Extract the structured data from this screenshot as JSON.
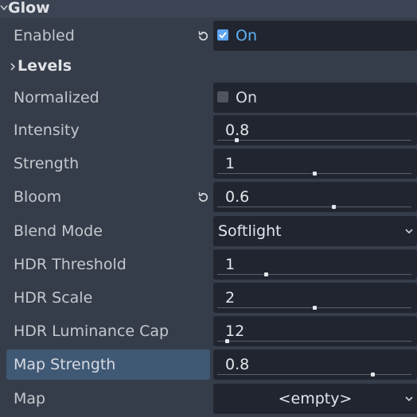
{
  "section": {
    "title": "Glow"
  },
  "levels": {
    "title": "Levels"
  },
  "enabled": {
    "label": "Enabled",
    "checked": true,
    "value_label": "On"
  },
  "normalized": {
    "label": "Normalized",
    "checked": false,
    "value_label": "On"
  },
  "intensity": {
    "label": "Intensity",
    "value": "0.8",
    "level": 0.1
  },
  "strength": {
    "label": "Strength",
    "value": "1",
    "level": 0.5
  },
  "bloom": {
    "label": "Bloom",
    "value": "0.6",
    "level": 0.6
  },
  "blend_mode": {
    "label": "Blend Mode",
    "selected": "Softlight"
  },
  "hdr_threshold": {
    "label": "HDR Threshold",
    "value": "1",
    "level": 0.25
  },
  "hdr_scale": {
    "label": "HDR Scale",
    "value": "2",
    "level": 0.5
  },
  "hdr_luminance_cap": {
    "label": "HDR Luminance Cap",
    "value": "12",
    "level": 0.05
  },
  "map_strength": {
    "label": "Map Strength",
    "value": "0.8",
    "level": 0.8
  },
  "map": {
    "label": "Map",
    "value": "<empty>"
  },
  "colors": {
    "accent": "#5fa5f3",
    "highlight": "#3f5874",
    "field_bg": "#212530",
    "panel_bg": "#363d4a"
  }
}
